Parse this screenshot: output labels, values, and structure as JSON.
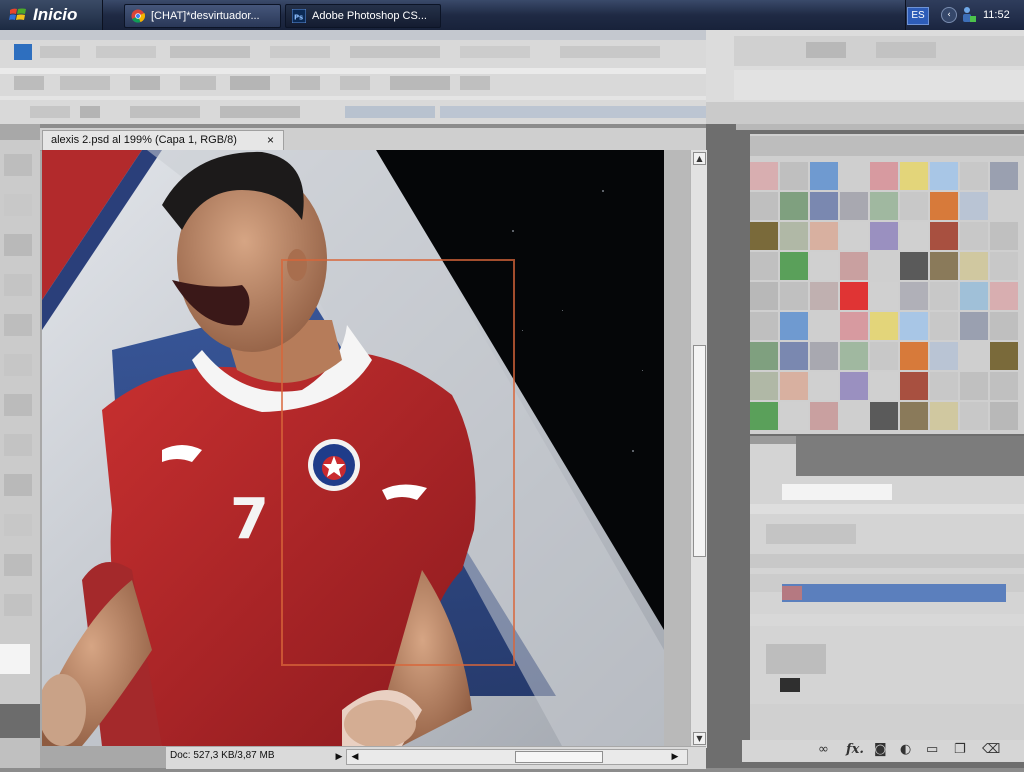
{
  "taskbar": {
    "start_label": "Inicio",
    "tasks": [
      {
        "label": "[CHAT]*desvirtuador...",
        "icon": "chrome-icon"
      },
      {
        "label": "Adobe Photoshop CS...",
        "icon": "photoshop-icon"
      }
    ],
    "language": "ES",
    "clock": "11:52"
  },
  "document": {
    "tab_title": "alexis 2.psd al 199% (Capa 1, RGB/8)",
    "close_glyph": "×",
    "status_info": "Doc: 527,3 KB/3,87 MB",
    "player_number": "7"
  },
  "panel_icons": [
    "link-icon",
    "fx-icon",
    "mask-icon",
    "adjustment-icon",
    "folder-icon",
    "new-layer-icon",
    "trash-icon"
  ],
  "panel_fx_label": "fx.",
  "colors": {
    "taskbar": "#1f2a44",
    "jersey_red": "#c0282a",
    "flag_blue": "#234a9a",
    "selection": "#d8653a"
  }
}
